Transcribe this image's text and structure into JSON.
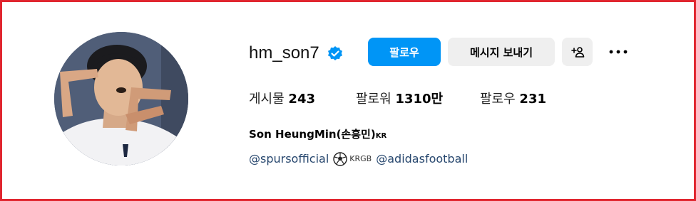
{
  "profile": {
    "username": "hm_son7",
    "verified": true,
    "full_name": "Son HeungMin(손흥민)",
    "name_flag": "KR",
    "avatar_icon": "profile-photo"
  },
  "actions": {
    "follow_label": "팔로우",
    "message_label": "메시지 보내기",
    "add_user_icon": "add-person-icon",
    "more_icon": "ellipsis-icon"
  },
  "stats": {
    "posts_label": "게시물",
    "posts_value": "243",
    "followers_label": "팔로워",
    "followers_value": "1310만",
    "following_label": "팔로우",
    "following_value": "231"
  },
  "bio": {
    "mention1": "@spursofficial",
    "ball_icon": "soccer-ball-icon",
    "flag_text": "KRGB",
    "mention2": "@adidasfootball"
  },
  "colors": {
    "primary": "#0095f6",
    "secondary_button": "#efefef",
    "link": "#27476e",
    "frame_border": "#e0262f"
  }
}
